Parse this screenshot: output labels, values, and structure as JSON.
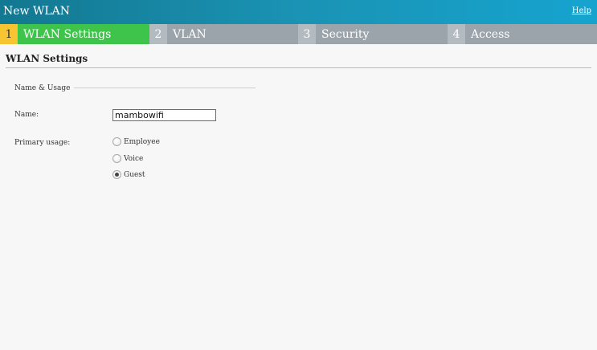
{
  "window": {
    "title": "New WLAN",
    "help_label": "Help"
  },
  "tabs": [
    {
      "number": "1",
      "label": "WLAN Settings",
      "active": true
    },
    {
      "number": "2",
      "label": "VLAN",
      "active": false
    },
    {
      "number": "3",
      "label": "Security",
      "active": false
    },
    {
      "number": "4",
      "label": "Access",
      "active": false
    }
  ],
  "section": {
    "title": "WLAN Settings"
  },
  "fieldset": {
    "legend": "Name & Usage"
  },
  "form": {
    "name_label": "Name:",
    "name_value": "mambowifi",
    "usage_label": "Primary usage:",
    "usage_options": [
      {
        "label": "Employee",
        "selected": false
      },
      {
        "label": "Voice",
        "selected": false
      },
      {
        "label": "Guest",
        "selected": true
      }
    ]
  },
  "colors": {
    "titlebar": "#1a93b4",
    "active_tab": "#3fc44b",
    "active_tab_number": "#f7c531",
    "inactive_tab": "#9ba4ab"
  }
}
